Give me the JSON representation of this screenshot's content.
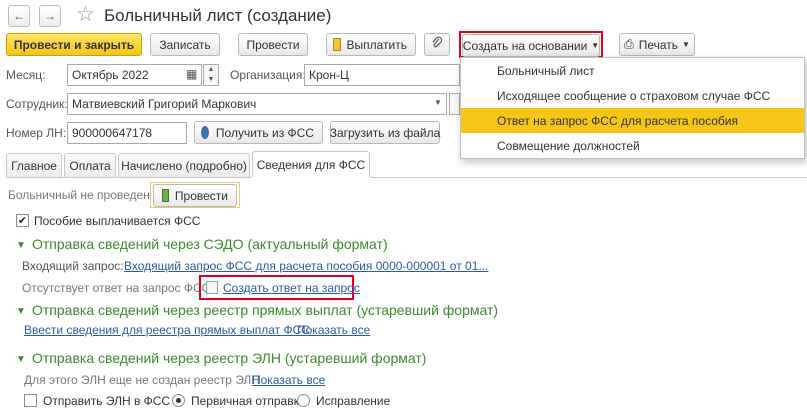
{
  "header": {
    "back_icon": "←",
    "forward_icon": "→",
    "star_icon": "☆",
    "title": "Больничный лист (создание)"
  },
  "toolbar": {
    "post_close": "Провести и закрыть",
    "save": "Записать",
    "post": "Провести",
    "pay": "Выплатить",
    "create_based": "Создать на основании",
    "print": "Печать"
  },
  "dropdown": {
    "items": [
      "Больничный лист",
      "Исходящее сообщение о страховом случае ФСС",
      "Ответ на запрос ФСС для расчета пособия",
      "Совмещение должностей"
    ],
    "selected_index": 2
  },
  "form": {
    "month_label": "Месяц:",
    "month_value": "Октябрь 2022",
    "org_label": "Организация:",
    "org_value": "Крон-Ц",
    "employee_label": "Сотрудник:",
    "employee_value": "Матвиевский Григорий Маркович",
    "number_label": "Номер ЛН:",
    "number_value": "900000647178",
    "get_fss": "Получить из ФСС",
    "load_file": "Загрузить из файла"
  },
  "tabs": [
    "Главное",
    "Оплата",
    "Начислено (подробно)",
    "Сведения для ФСС"
  ],
  "fss": {
    "not_posted": "Больничный не проведен",
    "post_button": "Провести",
    "benefit_paid": "Пособие выплачивается ФСС",
    "sedo_title": "Отправка сведений через СЭДО (актуальный формат)",
    "incoming_label": "Входящий запрос:",
    "incoming_link": "Входящий запрос ФСС для расчета пособия 0000-000001 от 01...",
    "no_answer": "Отсутствует ответ на запрос ФСС",
    "create_answer": "Создать ответ на запрос",
    "direct_title": "Отправка сведений через реестр прямых выплат (устаревший формат)",
    "direct_link": "Ввести сведения для реестра прямых выплат ФСС",
    "direct_show": "Показать все",
    "eln_title": "Отправка сведений через реестр ЭЛН (устаревший формат)",
    "eln_note": "Для этого ЭЛН еще не создан реестр ЭЛН",
    "eln_show": "Показать все",
    "send_eln": "Отправить ЭЛН в ФСС",
    "primary": "Первичная отправка",
    "correction": "Исправление"
  }
}
